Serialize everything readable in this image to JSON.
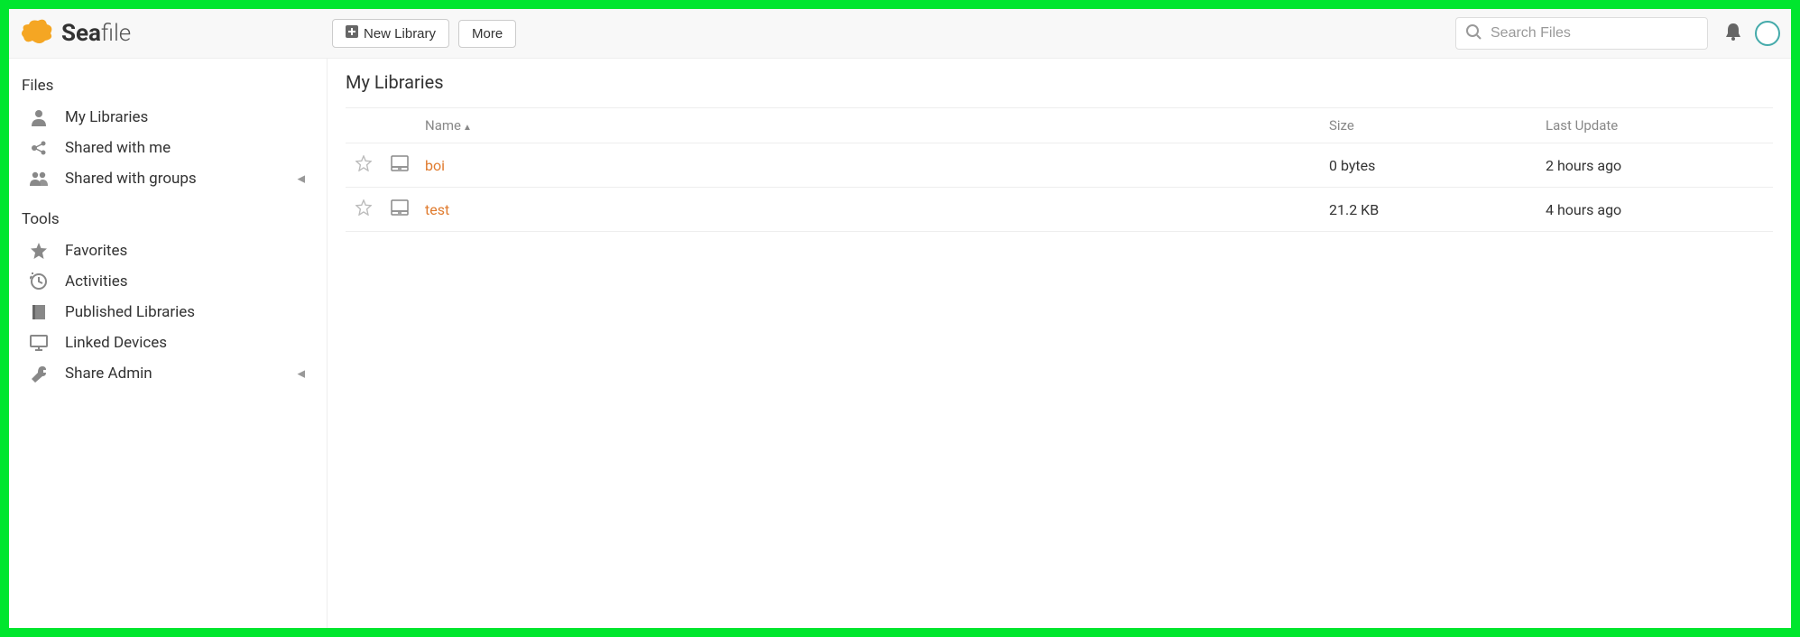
{
  "brand": {
    "bold": "Sea",
    "light": "file"
  },
  "topbar": {
    "new_library_label": "New Library",
    "more_label": "More",
    "search_placeholder": "Search Files"
  },
  "sidebar": {
    "sections": {
      "files_label": "Files",
      "tools_label": "Tools"
    },
    "files_items": [
      {
        "label": "My Libraries"
      },
      {
        "label": "Shared with me"
      },
      {
        "label": "Shared with groups"
      }
    ],
    "tools_items": [
      {
        "label": "Favorites"
      },
      {
        "label": "Activities"
      },
      {
        "label": "Published Libraries"
      },
      {
        "label": "Linked Devices"
      },
      {
        "label": "Share Admin"
      }
    ]
  },
  "main": {
    "page_title": "My Libraries",
    "columns": {
      "name": "Name",
      "size": "Size",
      "last_update": "Last Update"
    },
    "rows": [
      {
        "name": "boi",
        "size": "0 bytes",
        "last_update": "2 hours ago"
      },
      {
        "name": "test",
        "size": "21.2 KB",
        "last_update": "4 hours ago"
      }
    ]
  }
}
